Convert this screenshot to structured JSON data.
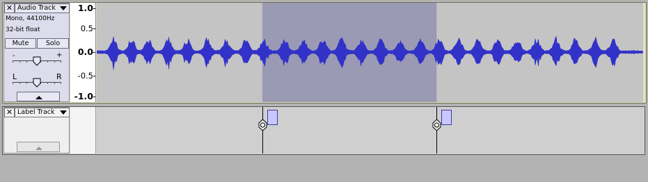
{
  "audio_track": {
    "close_glyph": "✕",
    "name": "Audio Track",
    "info_line1": "Mono, 44100Hz",
    "info_line2": "32-bit float",
    "mute_label": "Mute",
    "solo_label": "Solo",
    "gain_minus": "-",
    "gain_plus": "+",
    "pan_left": "L",
    "pan_right": "R",
    "gain_value": 0.5,
    "pan_value": 0.5,
    "y_axis_labels": [
      "1.0",
      "0.5",
      "0.0",
      "-0.5",
      "-1.0"
    ],
    "selection_start_fraction": 0.303,
    "selection_end_fraction": 0.622,
    "colors": {
      "track_border": "#e2e2c0",
      "waveform": "#3232c8",
      "background": "#c4c4c4",
      "selection": "#9a9ab4"
    }
  },
  "label_track": {
    "close_glyph": "✕",
    "name": "Label Track",
    "label_position_fractions": [
      0.303,
      0.622
    ]
  }
}
